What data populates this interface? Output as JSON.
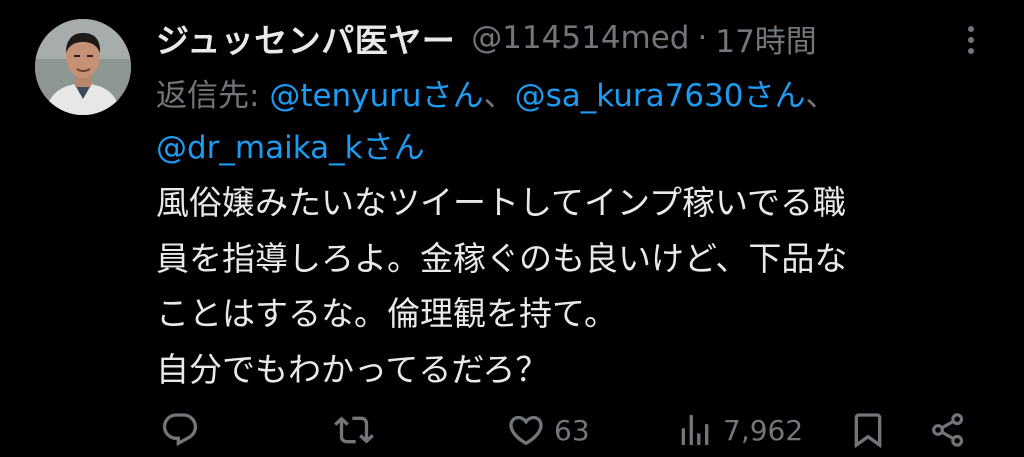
{
  "tweet": {
    "display_name": "ジュッセンパ医ヤー",
    "handle": "@114514med",
    "separator": "·",
    "time": "17時間",
    "reply_to": {
      "prefix": "返信先: ",
      "mentions": [
        "@tenyuruさん",
        "@sa_kura7630さん",
        "@dr_maika_kさん"
      ],
      "separator": "、"
    },
    "body_lines": [
      "風俗嬢みたいなツイートしてインプ稼いでる職",
      "員を指導しろよ。金稼ぐのも良いけど、下品な",
      "ことはするな。倫理観を持て。",
      "自分でもわかってるだろ？"
    ],
    "actions": {
      "reply": {
        "icon": "reply-icon",
        "count": ""
      },
      "retweet": {
        "icon": "retweet-icon",
        "count": ""
      },
      "like": {
        "icon": "heart-icon",
        "count": "63"
      },
      "views": {
        "icon": "views-icon",
        "count": "7,962"
      },
      "bookmark": {
        "icon": "bookmark-icon",
        "count": ""
      },
      "share": {
        "icon": "share-icon",
        "count": ""
      }
    }
  },
  "colors": {
    "background": "#000000",
    "text": "#e7e9ea",
    "muted": "#71767b",
    "accent": "#1d9bf0"
  }
}
